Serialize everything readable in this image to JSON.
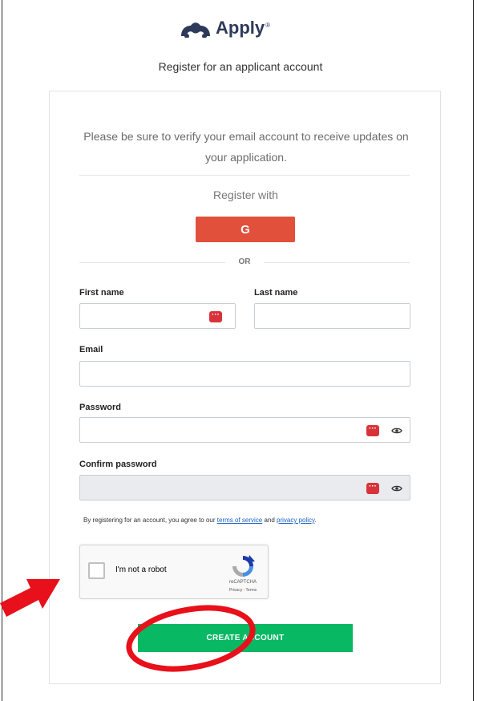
{
  "header": {
    "logo_text": "Apply",
    "logo_tm": "®",
    "subtitle": "Register for an applicant account"
  },
  "form": {
    "notice": "Please be sure to verify your email account to receive updates on your application.",
    "register_with": "Register with",
    "google_label": "G",
    "or_label": "OR",
    "first_name_label": "First name",
    "last_name_label": "Last name",
    "email_label": "Email",
    "password_label": "Password",
    "confirm_password_label": "Confirm password",
    "password_manager_glyph": "···",
    "terms_prefix": "By registering for an account, you agree to our ",
    "terms_link": "terms of service",
    "terms_and": " and ",
    "privacy_link": "privacy policy",
    "terms_suffix": ".",
    "submit_label": "CREATE ACCOUNT"
  },
  "captcha": {
    "label": "I'm not a robot",
    "brand": "reCAPTCHA",
    "links": "Privacy - Terms"
  },
  "icons": {
    "logo": "surveymonkey-logo-icon",
    "password_manager": "password-manager-icon",
    "eye": "eye-icon",
    "recaptcha": "recaptcha-icon",
    "annotation_arrow": "red-arrow-annotation",
    "annotation_circle": "red-circle-annotation"
  },
  "colors": {
    "google": "#e0503a",
    "submit": "#08b863",
    "password_manager": "#d8333a",
    "annotation": "#e8101a",
    "link": "#1d61c4"
  }
}
